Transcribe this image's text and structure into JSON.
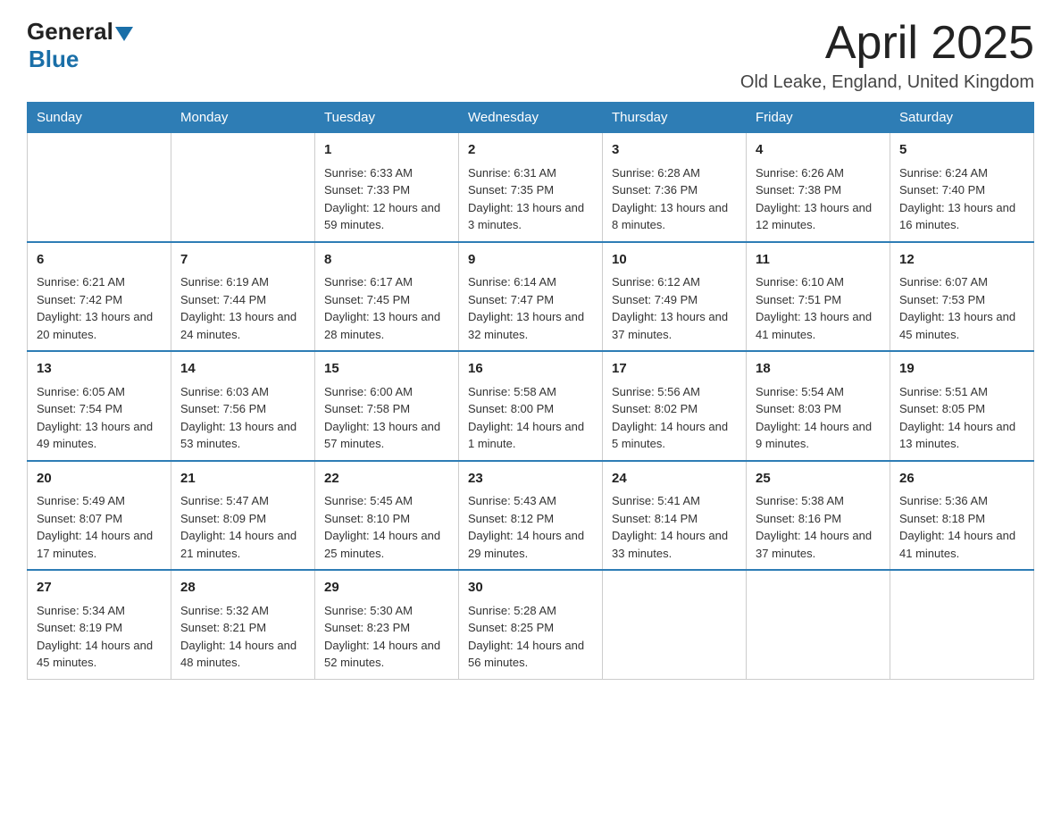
{
  "header": {
    "logo_general": "General",
    "logo_blue": "Blue",
    "title": "April 2025",
    "location": "Old Leake, England, United Kingdom"
  },
  "days_of_week": [
    "Sunday",
    "Monday",
    "Tuesday",
    "Wednesday",
    "Thursday",
    "Friday",
    "Saturday"
  ],
  "weeks": [
    [
      {
        "day": "",
        "sunrise": "",
        "sunset": "",
        "daylight": ""
      },
      {
        "day": "",
        "sunrise": "",
        "sunset": "",
        "daylight": ""
      },
      {
        "day": "1",
        "sunrise": "Sunrise: 6:33 AM",
        "sunset": "Sunset: 7:33 PM",
        "daylight": "Daylight: 12 hours and 59 minutes."
      },
      {
        "day": "2",
        "sunrise": "Sunrise: 6:31 AM",
        "sunset": "Sunset: 7:35 PM",
        "daylight": "Daylight: 13 hours and 3 minutes."
      },
      {
        "day": "3",
        "sunrise": "Sunrise: 6:28 AM",
        "sunset": "Sunset: 7:36 PM",
        "daylight": "Daylight: 13 hours and 8 minutes."
      },
      {
        "day": "4",
        "sunrise": "Sunrise: 6:26 AM",
        "sunset": "Sunset: 7:38 PM",
        "daylight": "Daylight: 13 hours and 12 minutes."
      },
      {
        "day": "5",
        "sunrise": "Sunrise: 6:24 AM",
        "sunset": "Sunset: 7:40 PM",
        "daylight": "Daylight: 13 hours and 16 minutes."
      }
    ],
    [
      {
        "day": "6",
        "sunrise": "Sunrise: 6:21 AM",
        "sunset": "Sunset: 7:42 PM",
        "daylight": "Daylight: 13 hours and 20 minutes."
      },
      {
        "day": "7",
        "sunrise": "Sunrise: 6:19 AM",
        "sunset": "Sunset: 7:44 PM",
        "daylight": "Daylight: 13 hours and 24 minutes."
      },
      {
        "day": "8",
        "sunrise": "Sunrise: 6:17 AM",
        "sunset": "Sunset: 7:45 PM",
        "daylight": "Daylight: 13 hours and 28 minutes."
      },
      {
        "day": "9",
        "sunrise": "Sunrise: 6:14 AM",
        "sunset": "Sunset: 7:47 PM",
        "daylight": "Daylight: 13 hours and 32 minutes."
      },
      {
        "day": "10",
        "sunrise": "Sunrise: 6:12 AM",
        "sunset": "Sunset: 7:49 PM",
        "daylight": "Daylight: 13 hours and 37 minutes."
      },
      {
        "day": "11",
        "sunrise": "Sunrise: 6:10 AM",
        "sunset": "Sunset: 7:51 PM",
        "daylight": "Daylight: 13 hours and 41 minutes."
      },
      {
        "day": "12",
        "sunrise": "Sunrise: 6:07 AM",
        "sunset": "Sunset: 7:53 PM",
        "daylight": "Daylight: 13 hours and 45 minutes."
      }
    ],
    [
      {
        "day": "13",
        "sunrise": "Sunrise: 6:05 AM",
        "sunset": "Sunset: 7:54 PM",
        "daylight": "Daylight: 13 hours and 49 minutes."
      },
      {
        "day": "14",
        "sunrise": "Sunrise: 6:03 AM",
        "sunset": "Sunset: 7:56 PM",
        "daylight": "Daylight: 13 hours and 53 minutes."
      },
      {
        "day": "15",
        "sunrise": "Sunrise: 6:00 AM",
        "sunset": "Sunset: 7:58 PM",
        "daylight": "Daylight: 13 hours and 57 minutes."
      },
      {
        "day": "16",
        "sunrise": "Sunrise: 5:58 AM",
        "sunset": "Sunset: 8:00 PM",
        "daylight": "Daylight: 14 hours and 1 minute."
      },
      {
        "day": "17",
        "sunrise": "Sunrise: 5:56 AM",
        "sunset": "Sunset: 8:02 PM",
        "daylight": "Daylight: 14 hours and 5 minutes."
      },
      {
        "day": "18",
        "sunrise": "Sunrise: 5:54 AM",
        "sunset": "Sunset: 8:03 PM",
        "daylight": "Daylight: 14 hours and 9 minutes."
      },
      {
        "day": "19",
        "sunrise": "Sunrise: 5:51 AM",
        "sunset": "Sunset: 8:05 PM",
        "daylight": "Daylight: 14 hours and 13 minutes."
      }
    ],
    [
      {
        "day": "20",
        "sunrise": "Sunrise: 5:49 AM",
        "sunset": "Sunset: 8:07 PM",
        "daylight": "Daylight: 14 hours and 17 minutes."
      },
      {
        "day": "21",
        "sunrise": "Sunrise: 5:47 AM",
        "sunset": "Sunset: 8:09 PM",
        "daylight": "Daylight: 14 hours and 21 minutes."
      },
      {
        "day": "22",
        "sunrise": "Sunrise: 5:45 AM",
        "sunset": "Sunset: 8:10 PM",
        "daylight": "Daylight: 14 hours and 25 minutes."
      },
      {
        "day": "23",
        "sunrise": "Sunrise: 5:43 AM",
        "sunset": "Sunset: 8:12 PM",
        "daylight": "Daylight: 14 hours and 29 minutes."
      },
      {
        "day": "24",
        "sunrise": "Sunrise: 5:41 AM",
        "sunset": "Sunset: 8:14 PM",
        "daylight": "Daylight: 14 hours and 33 minutes."
      },
      {
        "day": "25",
        "sunrise": "Sunrise: 5:38 AM",
        "sunset": "Sunset: 8:16 PM",
        "daylight": "Daylight: 14 hours and 37 minutes."
      },
      {
        "day": "26",
        "sunrise": "Sunrise: 5:36 AM",
        "sunset": "Sunset: 8:18 PM",
        "daylight": "Daylight: 14 hours and 41 minutes."
      }
    ],
    [
      {
        "day": "27",
        "sunrise": "Sunrise: 5:34 AM",
        "sunset": "Sunset: 8:19 PM",
        "daylight": "Daylight: 14 hours and 45 minutes."
      },
      {
        "day": "28",
        "sunrise": "Sunrise: 5:32 AM",
        "sunset": "Sunset: 8:21 PM",
        "daylight": "Daylight: 14 hours and 48 minutes."
      },
      {
        "day": "29",
        "sunrise": "Sunrise: 5:30 AM",
        "sunset": "Sunset: 8:23 PM",
        "daylight": "Daylight: 14 hours and 52 minutes."
      },
      {
        "day": "30",
        "sunrise": "Sunrise: 5:28 AM",
        "sunset": "Sunset: 8:25 PM",
        "daylight": "Daylight: 14 hours and 56 minutes."
      },
      {
        "day": "",
        "sunrise": "",
        "sunset": "",
        "daylight": ""
      },
      {
        "day": "",
        "sunrise": "",
        "sunset": "",
        "daylight": ""
      },
      {
        "day": "",
        "sunrise": "",
        "sunset": "",
        "daylight": ""
      }
    ]
  ]
}
